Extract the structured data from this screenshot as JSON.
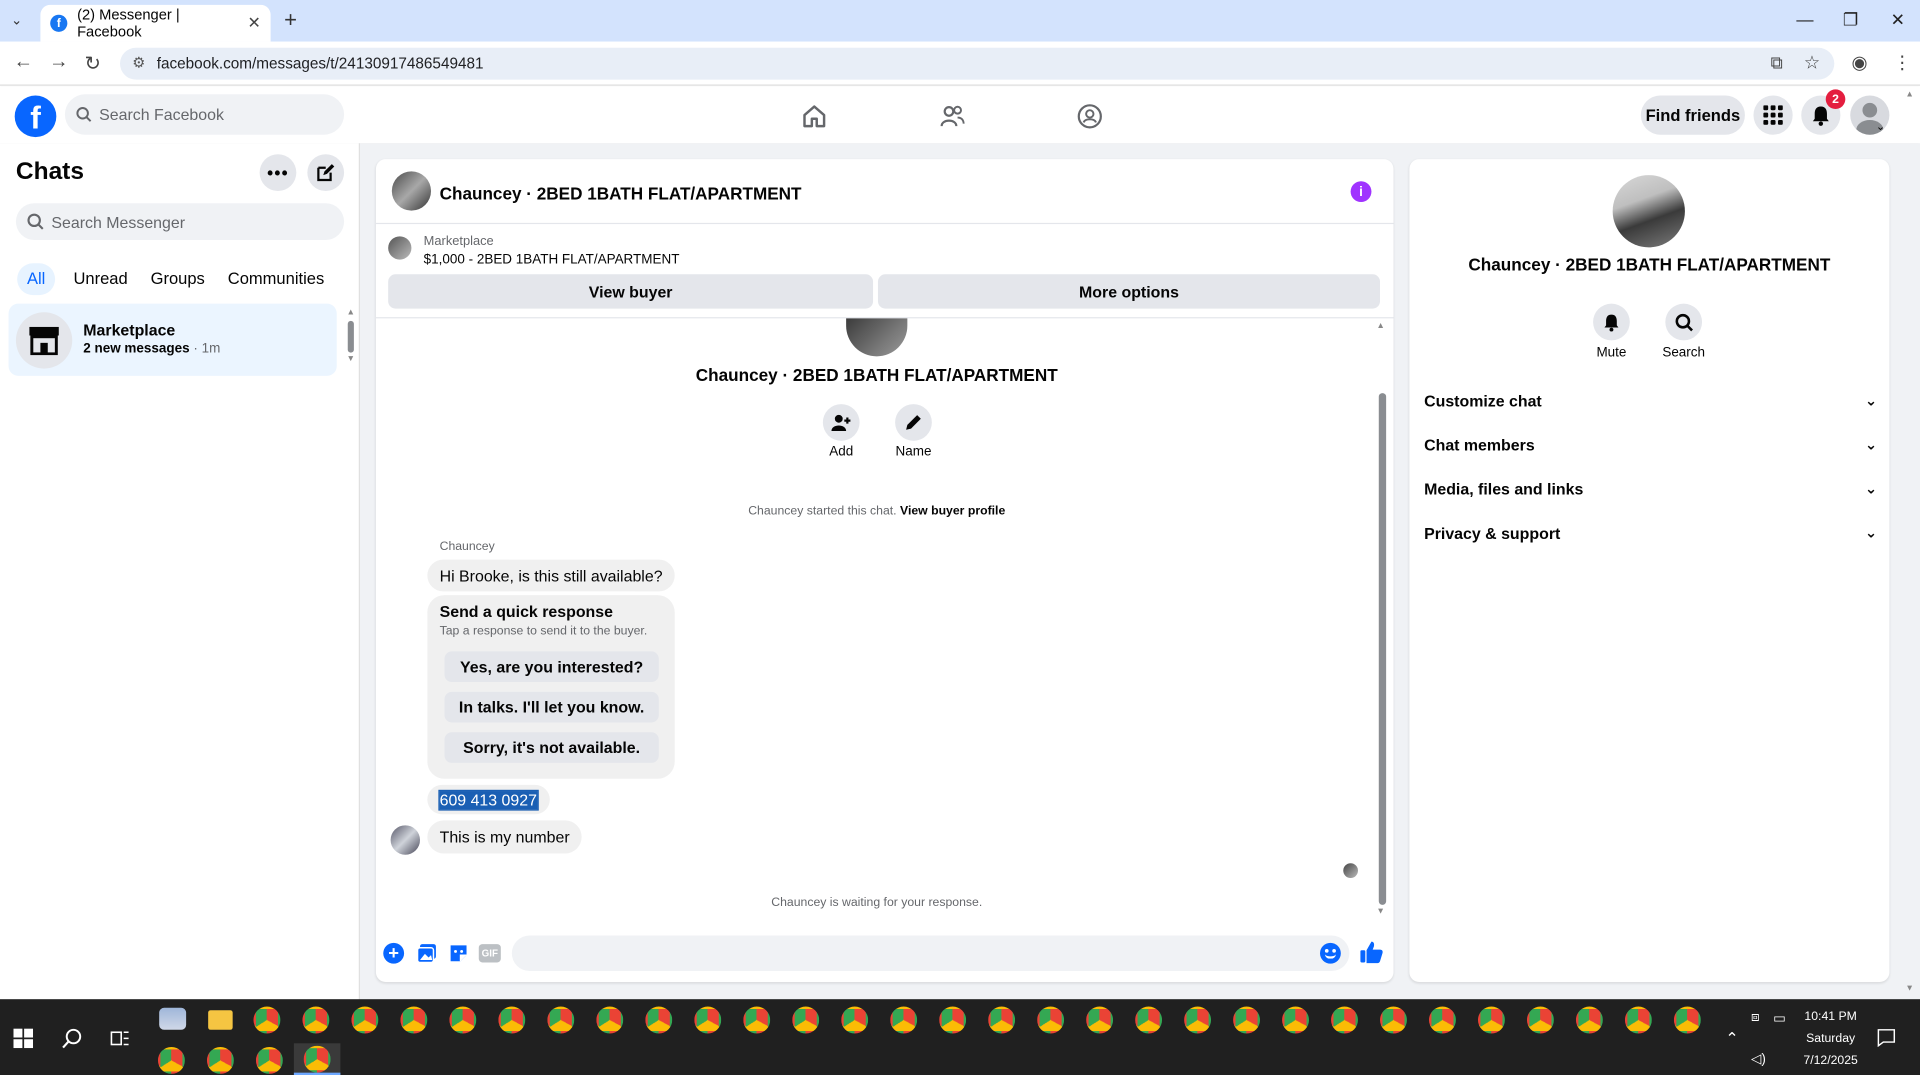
{
  "browser": {
    "tab_title": "(2) Messenger | Facebook",
    "url": "facebook.com/messages/t/24130917486549481"
  },
  "fb": {
    "search_placeholder": "Search Facebook",
    "find_friends": "Find friends",
    "notif_count": "2"
  },
  "sidebar": {
    "title": "Chats",
    "search_placeholder": "Search Messenger",
    "filters": [
      "All",
      "Unread",
      "Groups",
      "Communities"
    ],
    "chat": {
      "name": "Marketplace",
      "preview": "2 new messages",
      "time": "1m"
    }
  },
  "conversation": {
    "title": "Chauncey · 2BED 1BATH FLAT/APARTMENT",
    "listing_label": "Marketplace",
    "listing_detail": "$1,000 - 2BED 1BATH FLAT/APARTMENT",
    "view_buyer": "View buyer",
    "more_options": "More options",
    "intro_name": "Chauncey · 2BED 1BATH FLAT/APARTMENT",
    "add_label": "Add",
    "name_label": "Name",
    "started_text": "Chauncey started this chat.",
    "view_profile": "View buyer profile",
    "sender": "Chauncey",
    "msg1": "Hi Brooke, is this still available?",
    "quick_title": "Send a quick response",
    "quick_sub": "Tap a response to send it to the buyer.",
    "quick_responses": [
      "Yes, are you interested?",
      "In talks. I'll let you know.",
      "Sorry, it's not available."
    ],
    "msg2": "609 413 0927",
    "msg3": "This is my number",
    "waiting": "Chauncey is waiting for your response."
  },
  "details": {
    "name": "Chauncey · 2BED 1BATH FLAT/APARTMENT",
    "mute": "Mute",
    "search": "Search",
    "sections": [
      "Customize chat",
      "Chat members",
      "Media, files and links",
      "Privacy & support"
    ]
  },
  "taskbar": {
    "time": "10:41 PM",
    "day": "Saturday",
    "date": "7/12/2025"
  },
  "colors": {
    "brand": "#0866ff",
    "accent": "#a033ff",
    "badge": "#e41e3f"
  }
}
